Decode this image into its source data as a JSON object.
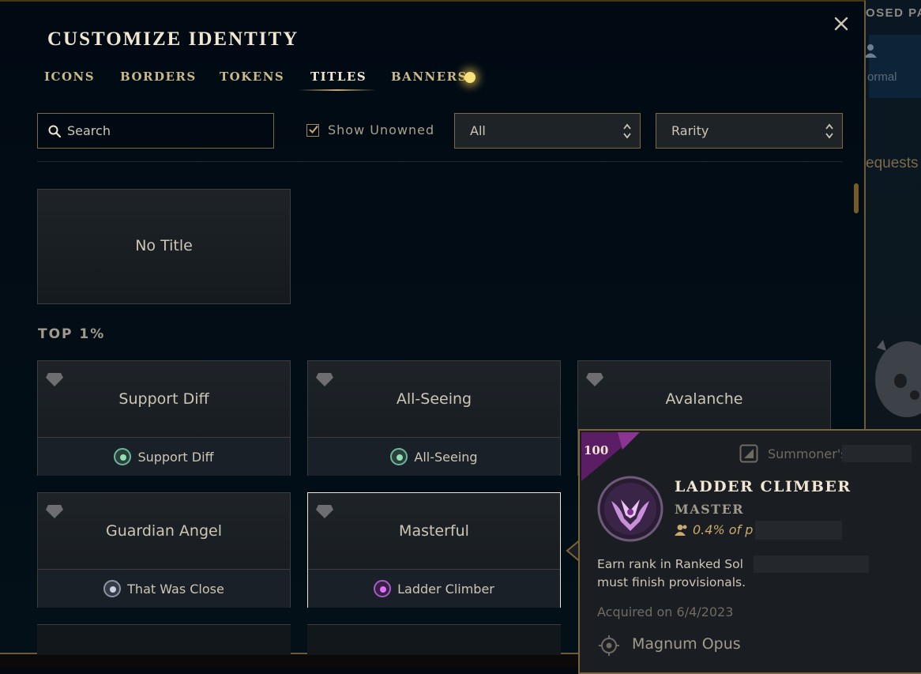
{
  "background": {
    "panel_title": "OSED PA",
    "queue_mode": "ormal",
    "requests": "equests"
  },
  "modal": {
    "title": "CUSTOMIZE IDENTITY",
    "tabs": [
      {
        "label": "ICONS",
        "active": false
      },
      {
        "label": "BORDERS",
        "active": false
      },
      {
        "label": "TOKENS",
        "active": false
      },
      {
        "label": "TITLES",
        "active": true
      },
      {
        "label": "BANNERS",
        "active": false,
        "notification": true
      }
    ]
  },
  "filters": {
    "search_placeholder": "Search",
    "search_value": "",
    "show_unowned_label": "Show Unowned",
    "show_unowned_checked": true,
    "category_selected": "All",
    "rarity_selected": "Rarity"
  },
  "titles": {
    "no_title_label": "No Title",
    "section_label": "TOP 1%",
    "cards": [
      {
        "name": "Support Diff",
        "challenge": "Support Diff",
        "orb": "green"
      },
      {
        "name": "All-Seeing",
        "challenge": "All-Seeing",
        "orb": "green"
      },
      {
        "name": "Avalanche",
        "challenge": "",
        "orb": ""
      },
      {
        "name": "Guardian Angel",
        "challenge": "That Was Close",
        "orb": "silver"
      },
      {
        "name": "Masterful",
        "challenge": "Ladder Climber",
        "orb": "purple",
        "selected": true
      }
    ]
  },
  "tooltip": {
    "level": "100",
    "category": "Summoner's",
    "challenge_name": "LADDER CLIMBER",
    "tier": "MASTER",
    "percent": "0.4% of p",
    "description_lines": [
      "Earn rank in Ranked Sol",
      "must finish provisionals."
    ],
    "acquired": "Acquired on 6/4/2023",
    "capstone": "Magnum Opus"
  },
  "colors": {
    "gold": "#c8aa6e",
    "text_light": "#f0e6d2",
    "master_purple": "#a45fc4"
  }
}
